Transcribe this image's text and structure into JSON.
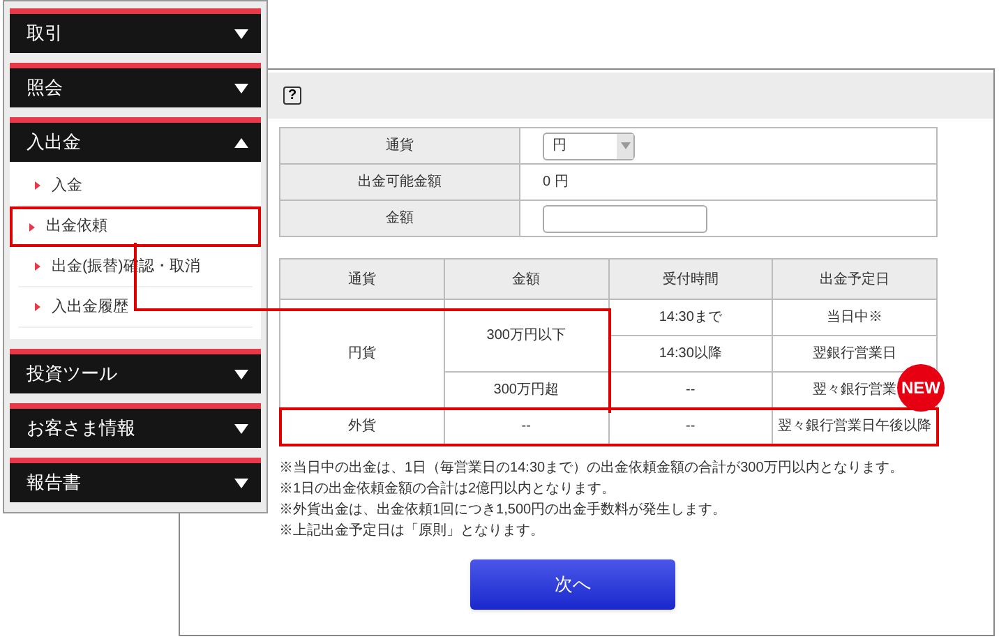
{
  "menu": {
    "sections": [
      {
        "label": "取引",
        "expanded": false
      },
      {
        "label": "照会",
        "expanded": false
      },
      {
        "label": "入出金",
        "expanded": true,
        "items": [
          {
            "label": "入金",
            "highlighted": false
          },
          {
            "label": "出金依頼",
            "highlighted": true
          },
          {
            "label": "出金(振替)確認・取消",
            "highlighted": false
          },
          {
            "label": "入出金履歴",
            "highlighted": false
          }
        ]
      },
      {
        "label": "投資ツール",
        "expanded": false
      },
      {
        "label": "お客さま情報",
        "expanded": false
      },
      {
        "label": "報告書",
        "expanded": false
      }
    ]
  },
  "main": {
    "help": "?",
    "form": [
      {
        "label": "通貨",
        "kind": "select",
        "value": "円"
      },
      {
        "label": "出金可能金額",
        "kind": "text",
        "value": "0 円"
      },
      {
        "label": "金額",
        "kind": "input"
      }
    ],
    "schedule": {
      "columns": [
        "通貨",
        "金額",
        "受付時間",
        "出金予定日"
      ],
      "rows": [
        {
          "currency": "円貨",
          "highlighted": false,
          "tiers": [
            {
              "amount": "300万円以下",
              "times": [
                {
                  "time": "14:30まで",
                  "date": "当日中※"
                },
                {
                  "time": "14:30以降",
                  "date": "翌銀行営業日"
                }
              ]
            },
            {
              "amount": "300万円超",
              "times": [
                {
                  "time": "--",
                  "date": "翌々銀行営業"
                }
              ]
            }
          ]
        },
        {
          "currency": "外貨",
          "highlighted": true,
          "badge": "NEW",
          "tiers": [
            {
              "amount": "--",
              "times": [
                {
                  "time": "--",
                  "date": "翌々銀行営業日午後以降"
                }
              ]
            }
          ]
        }
      ]
    },
    "notes": [
      "※当日中の出金は、1日（毎営業日の14:30まで）の出金依頼金額の合計が300万円以内となります。",
      "※1日の出金依頼金額の合計は2億円以内となります。",
      "※外貨出金は、出金依頼1回につき1,500円の出金手数料が発生します。",
      "※上記出金予定日は「原則」となります。"
    ],
    "next_button": "次へ"
  }
}
